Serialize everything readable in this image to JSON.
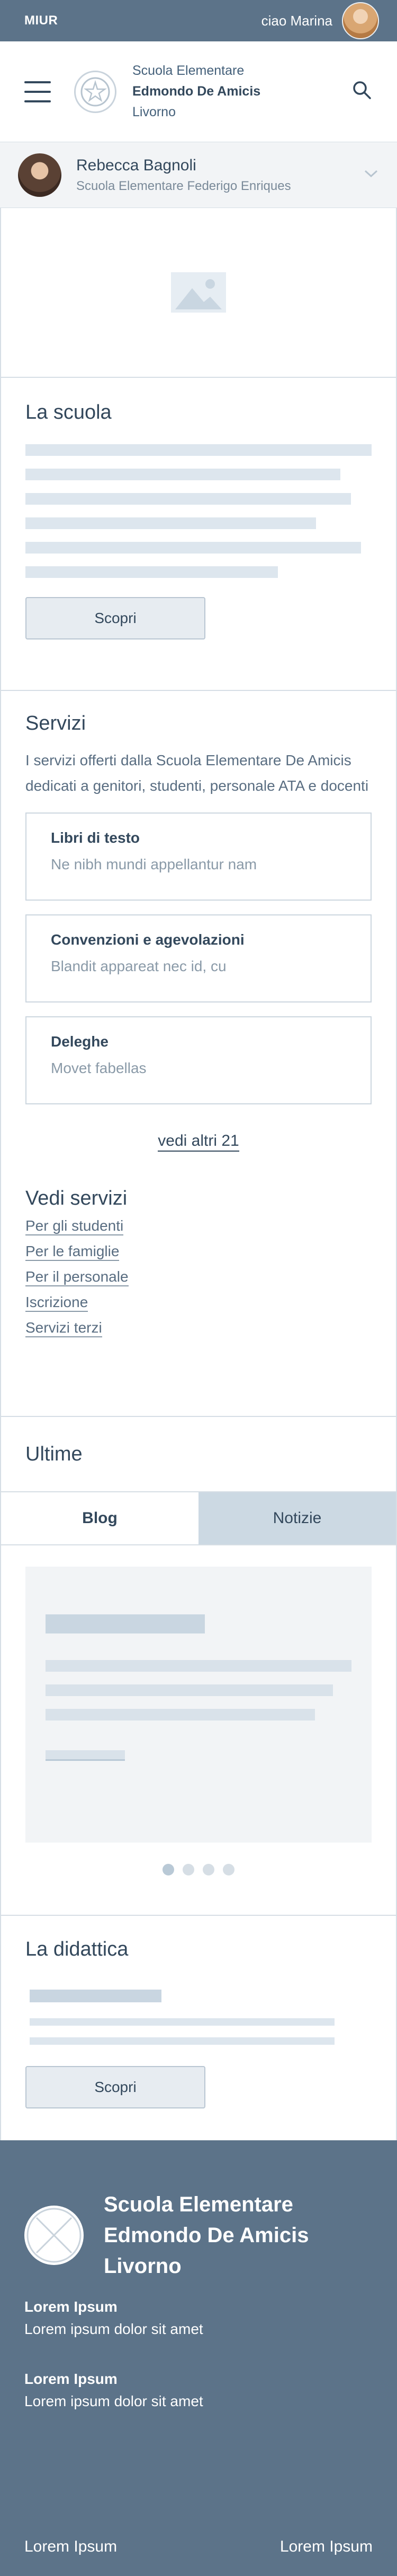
{
  "topbar": {
    "brand": "MIUR",
    "greeting": "ciao Marina"
  },
  "header": {
    "line1": "Scuola Elementare",
    "line2": "Edmondo De Amicis",
    "line3": "Livorno"
  },
  "profile": {
    "name": "Rebecca Bagnoli",
    "school": "Scuola Elementare Federigo Enriques"
  },
  "scuola": {
    "title": "La scuola",
    "button": "Scopri"
  },
  "servizi": {
    "title": "Servizi",
    "intro": "I servizi offerti dalla Scuola Elementare De Amicis dedicati a genitori, studenti, personale ATA e docenti",
    "cards": [
      {
        "title": "Libri di testo",
        "sub": "Ne nibh mundi appellantur nam"
      },
      {
        "title": "Convenzioni e agevolazioni",
        "sub": "Blandit appareat nec id, cu"
      },
      {
        "title": "Deleghe",
        "sub": "Movet fabellas"
      }
    ],
    "more": "vedi altri 21",
    "vedi_title": "Vedi servizi",
    "links": [
      "Per gli studenti",
      "Per le famiglie",
      "Per il personale",
      "Iscrizione",
      "Servizi terzi"
    ]
  },
  "ultime": {
    "title": "Ultime",
    "tab_blog": "Blog",
    "tab_notizie": "Notizie"
  },
  "didattica": {
    "title": "La didattica",
    "button": "Scopri"
  },
  "footer": {
    "line1": "Scuola Elementare",
    "line2": "Edmondo De Amicis",
    "line3": "Livorno",
    "block1_title": "Lorem Ipsum",
    "block1_text": "Lorem ipsum dolor sit amet",
    "block2_title": "Lorem Ipsum",
    "block2_text": "Lorem ipsum dolor sit amet",
    "bottom_left": "Lorem Ipsum",
    "bottom_right": "Lorem Ipsum"
  },
  "colors": {
    "primary": "#5c7389",
    "text": "#33485c",
    "placeholder": "#dde6ee"
  }
}
